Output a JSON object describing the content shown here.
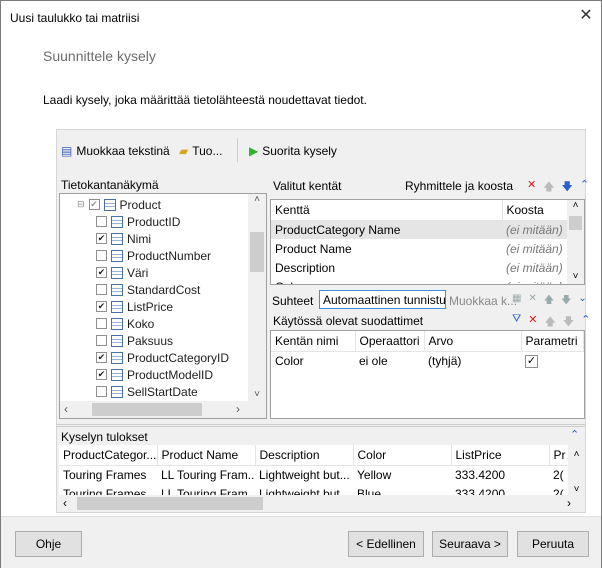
{
  "window": {
    "title": "Uusi taulukko tai matriisi",
    "close_icon": "close-icon"
  },
  "page": {
    "heading": "Suunnittele kysely",
    "instruction": "Laadi kysely, joka määrittää tietolähteestä noudettavat tiedot."
  },
  "toolbar": {
    "edit_text": "Muokkaa tekstinä",
    "import": "Tuo...",
    "run": "Suorita kysely"
  },
  "database_view": {
    "title": "Tietokantanäkymä",
    "table": "Product",
    "fields": [
      {
        "name": "ProductID",
        "checked": false
      },
      {
        "name": "Nimi",
        "checked": true
      },
      {
        "name": "ProductNumber",
        "checked": false
      },
      {
        "name": "Väri",
        "checked": true
      },
      {
        "name": "StandardCost",
        "checked": false
      },
      {
        "name": "ListPrice",
        "checked": true
      },
      {
        "name": "Koko",
        "checked": false
      },
      {
        "name": "Paksuus",
        "checked": false
      },
      {
        "name": "ProductCategoryID",
        "checked": true
      },
      {
        "name": "ProductModelID",
        "checked": true
      },
      {
        "name": "SellStartDate",
        "checked": false
      }
    ]
  },
  "selected_fields": {
    "title": "Valitut kentät",
    "group_label": "Ryhmittele ja koosta",
    "columns": [
      "Kenttä",
      "Koosta"
    ],
    "rows": [
      {
        "field": "ProductCategory Name",
        "aggregate": "(ei mitään)"
      },
      {
        "field": "Product Name",
        "aggregate": "(ei mitään)"
      },
      {
        "field": "Description",
        "aggregate": "(ei mitään)"
      },
      {
        "field": "Color",
        "aggregate": "(ei mitään)"
      }
    ]
  },
  "relations": {
    "label": "Suhteet",
    "auto_detect": "Automaattinen tunnistus",
    "edit": "Muokkaa k..."
  },
  "filters": {
    "title": "Käytössä olevat suodattimet",
    "columns": [
      "Kentän nimi",
      "Operaattori",
      "Arvo",
      "Parametri"
    ],
    "rows": [
      {
        "field": "Color",
        "operator": "ei ole",
        "value": "(tyhjä)",
        "parameter": true
      }
    ]
  },
  "results": {
    "title": "Kyselyn tulokset",
    "columns": [
      "ProductCategor...",
      "Product Name",
      "Description",
      "Color",
      "ListPrice",
      "Pr"
    ],
    "rows": [
      [
        "Touring Frames",
        "LL Touring Fram...",
        "Lightweight but...",
        "Yellow",
        "333.4200",
        "2("
      ],
      [
        "Touring Frames",
        "LL Touring Fram...",
        "Lightweight but...",
        "Blue",
        "333.4200",
        "2("
      ]
    ]
  },
  "buttons": {
    "help": "Ohje",
    "back": "< Edellinen",
    "next": "Seuraava >",
    "cancel": "Peruuta"
  }
}
